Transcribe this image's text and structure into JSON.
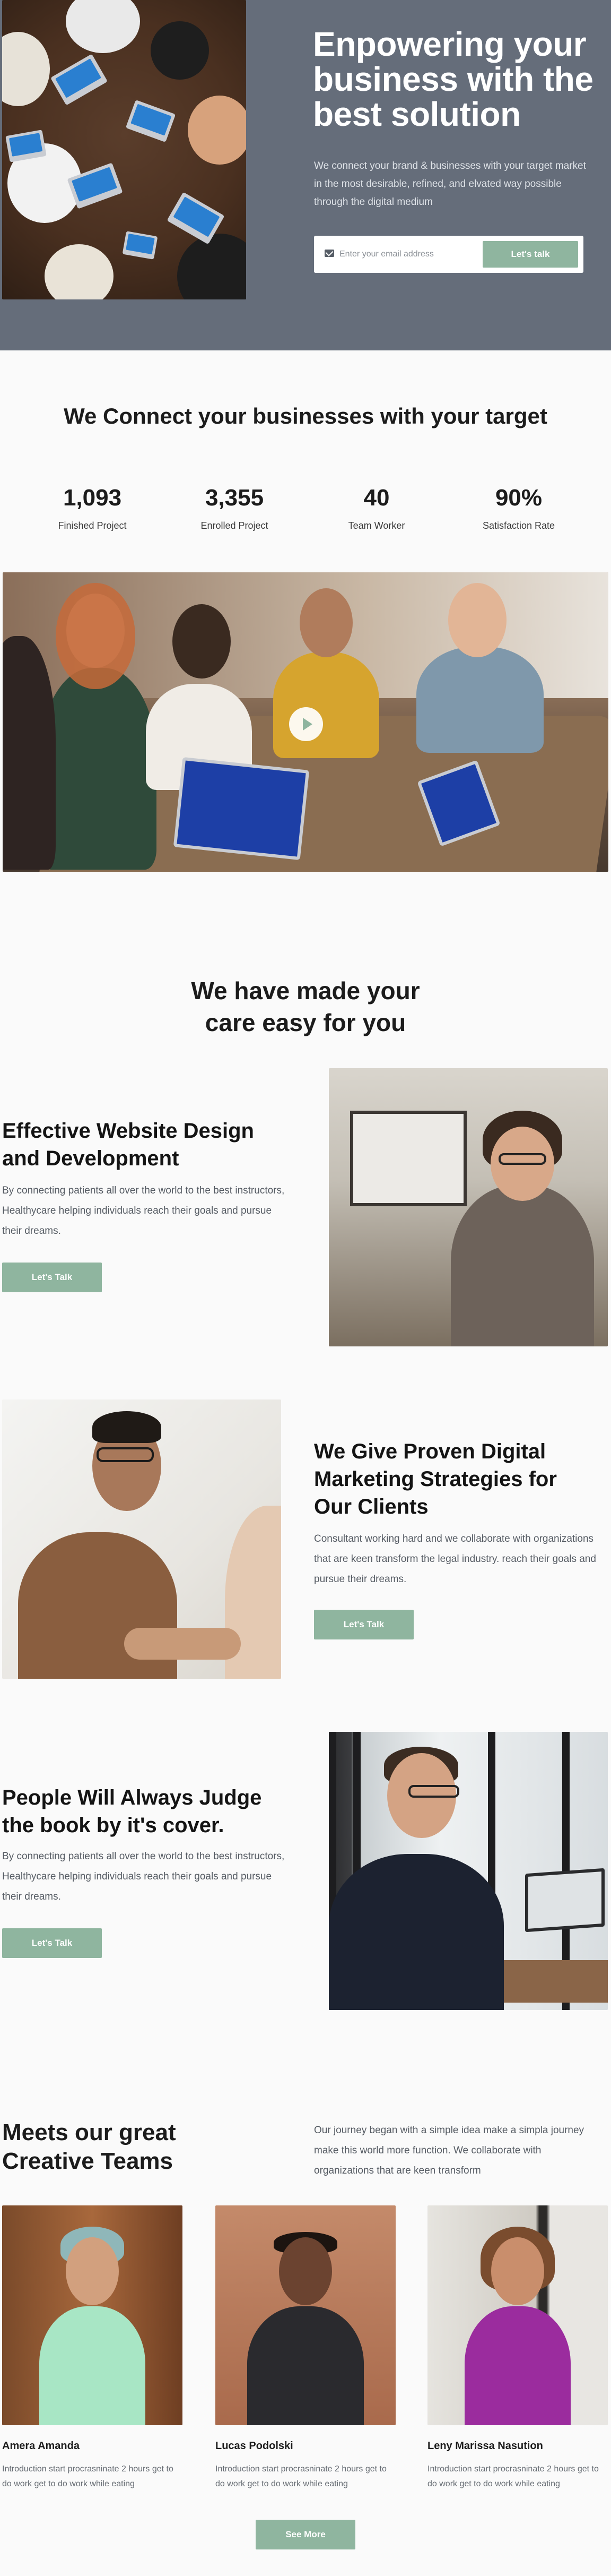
{
  "hero": {
    "title": "Enpowering your business with the best solution",
    "text": "We connect your brand & businesses with your target market in the most desirable, refined, and elvated way possible through the digital medium",
    "email_placeholder": "Enter your email address",
    "cta_label": "Let's talk"
  },
  "connect": {
    "title": "We Connect your businesses with your target",
    "stats": [
      {
        "value": "1,093",
        "label": "Finished Project"
      },
      {
        "value": "3,355",
        "label": "Enrolled Project"
      },
      {
        "value": "40",
        "label": "Team Worker"
      },
      {
        "value": "90%",
        "label": "Satisfaction Rate"
      }
    ]
  },
  "care": {
    "title": "We have made your care easy for you",
    "features": [
      {
        "title": "Effective Website Design and Development",
        "text": "By connecting patients all over the world to the best instructors, Healthycare helping individuals reach their goals and pursue their dreams.",
        "button": "Let's Talk"
      },
      {
        "title": "We Give Proven Digital Marketing Strategies for Our Clients",
        "text": "Consultant working hard and we collaborate with organizations that are keen transform the legal industry. reach their goals and pursue their dreams.",
        "button": "Let's Talk"
      },
      {
        "title": "People Will Always Judge the book by it's cover.",
        "text": "By connecting patients all over the world to the best instructors, Healthycare helping individuals reach their goals and pursue their dreams.",
        "button": "Let's Talk"
      }
    ]
  },
  "team": {
    "title": "Meets our great Creative Teams",
    "intro": "Our journey began with a simple idea make a simpla journey make this world more function. We collaborate with organizations that are keen transform",
    "members": [
      {
        "name": "Amera Amanda",
        "desc": "Introduction start procrasninate 2 hours get to do work get to do work while eating"
      },
      {
        "name": "Lucas Podolski",
        "desc": "Introduction start procrasninate 2 hours get to do work get to do work while eating"
      },
      {
        "name": "Leny Marissa Nasution",
        "desc": "Introduction start procrasninate 2 hours get to do work get to do work while eating"
      }
    ],
    "see_more": "See More"
  },
  "colors": {
    "hero_bg": "#656d7a",
    "accent_green": "#8fb59f",
    "page_bg": "#fafafa",
    "text_dark": "#1c1c1c",
    "text_muted": "#555b63"
  },
  "icons": {
    "email": "mail-icon",
    "video": "play-icon"
  }
}
